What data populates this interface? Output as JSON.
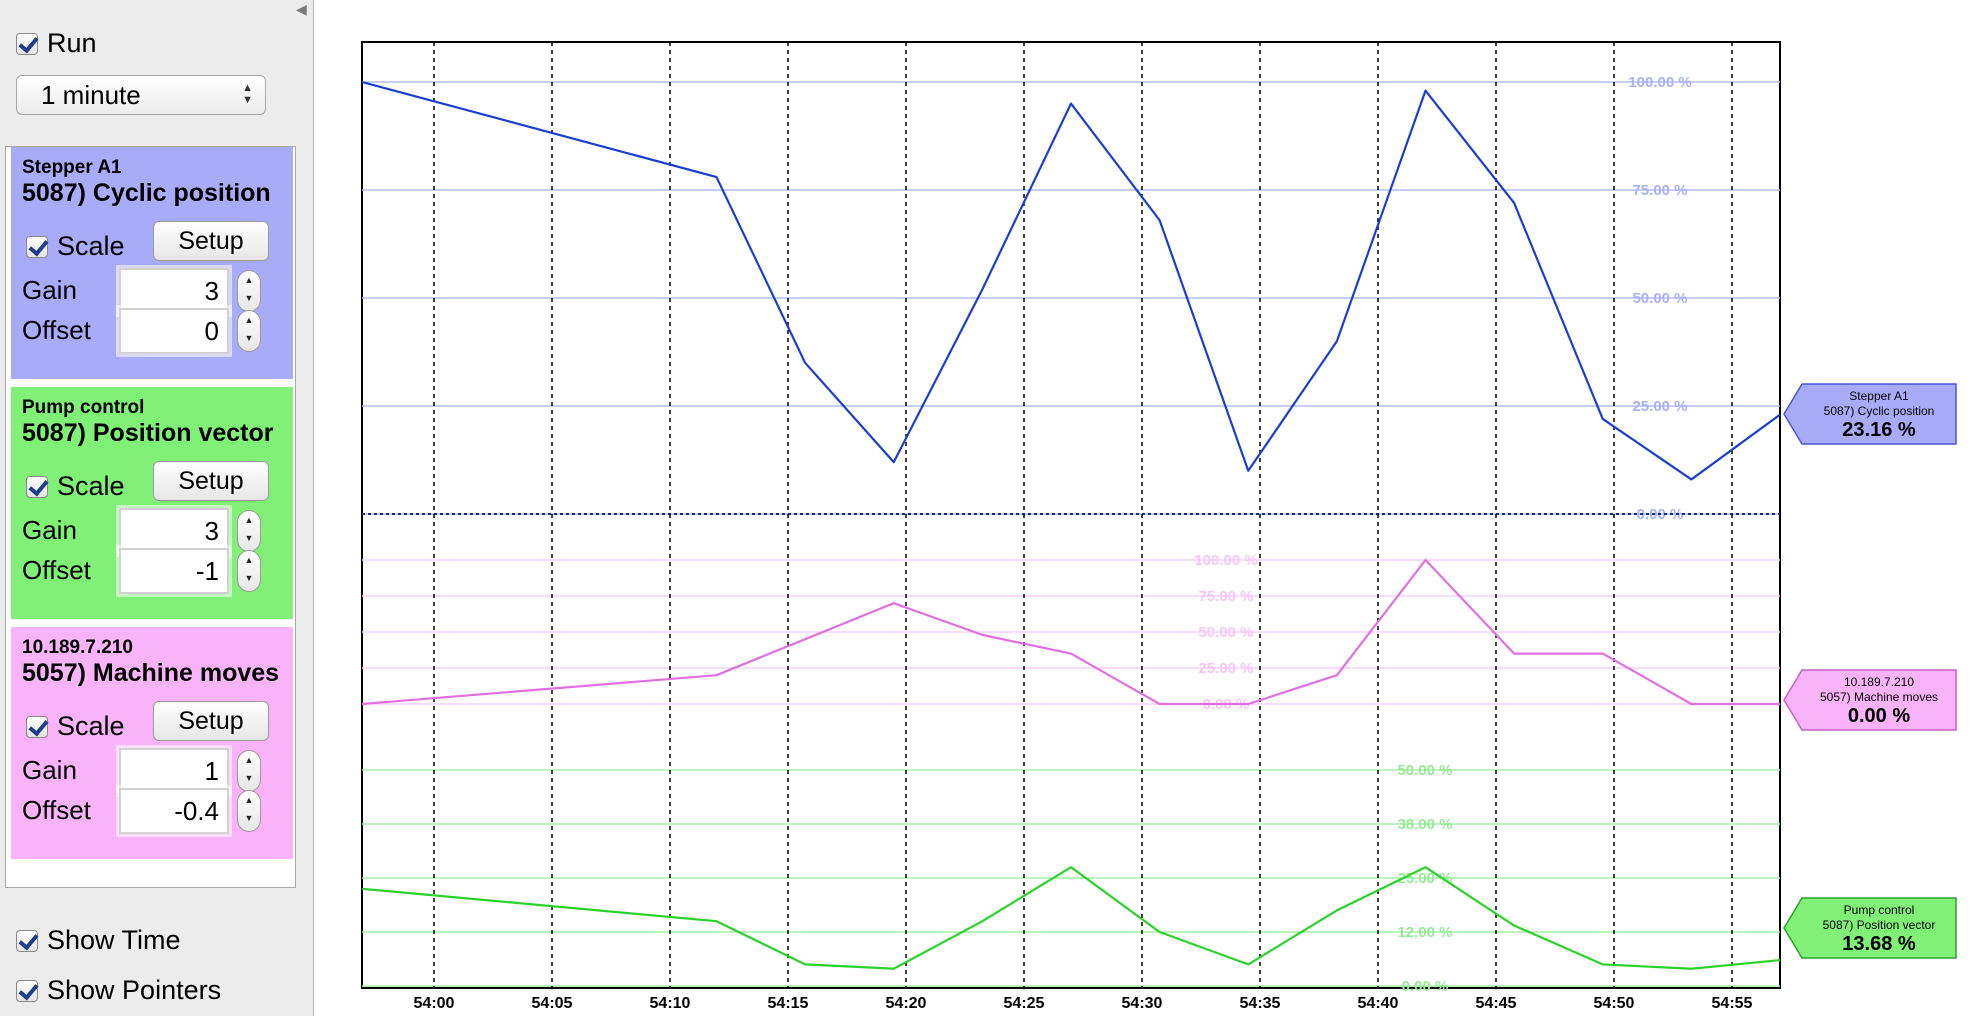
{
  "sidebar": {
    "run_label": "Run",
    "window_select": "1 minute",
    "show_time_label": "Show Time",
    "show_pointers_label": "Show Pointers"
  },
  "channels": [
    {
      "device": "Stepper A1",
      "variable": "5087) Cyclic position",
      "scale_label": "Scale",
      "setup_label": "Setup",
      "gain_label": "Gain",
      "gain": "3",
      "offset_label": "Offset",
      "offset": "0",
      "color": "#a8acf8",
      "readout": "23.16 %"
    },
    {
      "device": "Pump control",
      "variable": "5087) Position vector",
      "scale_label": "Scale",
      "setup_label": "Setup",
      "gain_label": "Gain",
      "gain": "3",
      "offset_label": "Offset",
      "offset": "-1",
      "color": "#80f077",
      "readout": "13.68 %"
    },
    {
      "device": "10.189.7.210",
      "variable": "5057) Machine moves",
      "scale_label": "Scale",
      "setup_label": "Setup",
      "gain_label": "Gain",
      "gain": "1",
      "offset_label": "Offset",
      "offset": "-0.4",
      "color": "#f9b3f9",
      "readout": "0.00 %"
    }
  ],
  "chart_data": {
    "type": "line",
    "x_ticks": [
      "54:00",
      "54:05",
      "54:10",
      "54:15",
      "54:20",
      "54:25",
      "54:30",
      "54:35",
      "54:40",
      "54:45",
      "54:50",
      "54:55"
    ],
    "blue_axis_ticks": [
      "100.00 %",
      "75.00 %",
      "50.00 %",
      "25.00 %",
      "0.00 %"
    ],
    "pink_axis_ticks": [
      "100.00 %",
      "75.00 %",
      "50.00 %",
      "25.00 %",
      "0.00 %"
    ],
    "green_axis_ticks": [
      "50.00 %",
      "38.00 %",
      "25.00 %",
      "12.00 %",
      "0.00 %"
    ],
    "colors": {
      "blue": "#1a3fd0",
      "pink": "#e070e0",
      "green": "#2ad22a"
    },
    "series": [
      {
        "key": "blue",
        "x": [
          53.8,
          54.0,
          54.05,
          54.1,
          54.15,
          54.2,
          54.25,
          54.3,
          54.35,
          54.4,
          54.45,
          54.5,
          54.55,
          54.6
        ],
        "y": [
          100,
          78,
          35,
          12,
          52,
          95,
          68,
          10,
          40,
          98,
          72,
          22,
          8,
          23
        ]
      },
      {
        "key": "pink",
        "x": [
          53.8,
          54.0,
          54.05,
          54.1,
          54.15,
          54.2,
          54.25,
          54.3,
          54.35,
          54.4,
          54.45,
          54.5,
          54.55,
          54.6
        ],
        "y": [
          0,
          20,
          45,
          70,
          48,
          35,
          0,
          0,
          20,
          100,
          35,
          35,
          0,
          0
        ]
      },
      {
        "key": "green",
        "x": [
          53.8,
          54.0,
          54.05,
          54.1,
          54.15,
          54.2,
          54.25,
          54.3,
          54.35,
          54.4,
          54.45,
          54.5,
          54.55,
          54.6
        ],
        "y": [
          45,
          30,
          10,
          8,
          30,
          55,
          25,
          10,
          35,
          55,
          28,
          10,
          8,
          12
        ]
      }
    ]
  }
}
